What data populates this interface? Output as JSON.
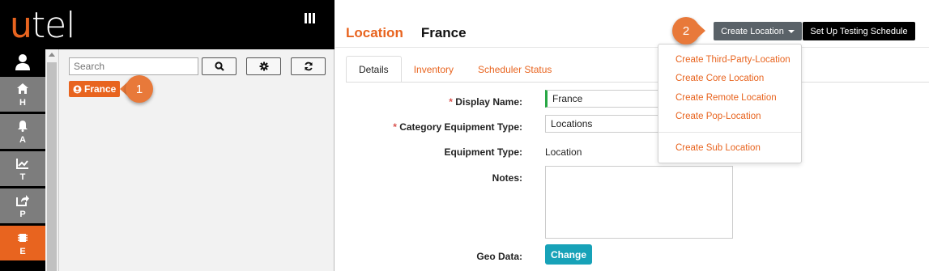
{
  "brand": {
    "logo_u": "u",
    "logo_rest": "tel",
    "accent": "#e8641f"
  },
  "nav": {
    "items": [
      {
        "letter": "H",
        "icon": "home-icon"
      },
      {
        "letter": "A",
        "icon": "bell-icon"
      },
      {
        "letter": "T",
        "icon": "chart-line-icon"
      },
      {
        "letter": "P",
        "icon": "share-icon"
      },
      {
        "letter": "E",
        "icon": "chip-icon",
        "active": true
      }
    ]
  },
  "tree": {
    "search_placeholder": "Search",
    "node_label": "France"
  },
  "callouts": {
    "one": "1",
    "two": "2"
  },
  "main": {
    "title_label": "Location",
    "title_name": "France",
    "create_button": "Create Location",
    "schedule_button": "Set Up Testing Schedule",
    "tabs": [
      "Details",
      "Inventory",
      "Scheduler Status"
    ],
    "form": {
      "display_name_label": "Display Name:",
      "display_name_value": "France",
      "category_label": "Category Equipment Type:",
      "category_value": "Locations",
      "equipment_type_label": "Equipment Type:",
      "equipment_type_value": "Location",
      "notes_label": "Notes:",
      "geo_label": "Geo Data:",
      "change_button": "Change",
      "required_mark": "*"
    },
    "dropdown": [
      "Create Third-Party-Location",
      "Create Core Location",
      "Create Remote Location",
      "Create Pop-Location",
      "Create Sub Location"
    ]
  }
}
